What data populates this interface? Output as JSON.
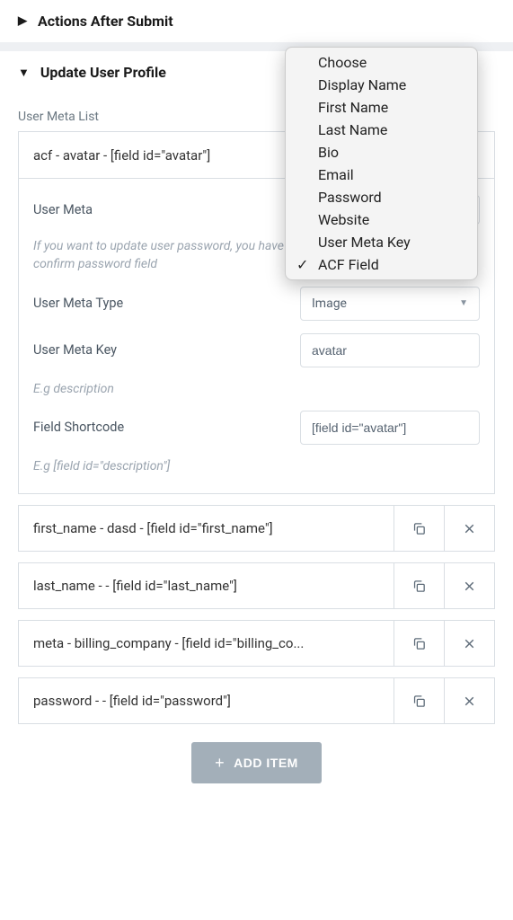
{
  "sections": {
    "actions_after_submit": {
      "title": "Actions After Submit"
    },
    "update_user_profile": {
      "title": "Update User Profile"
    }
  },
  "user_meta_list_label": "User Meta List",
  "expanded_item": {
    "title": "acf - avatar - [field id=\"avatar\"]",
    "user_meta_label": "User Meta",
    "user_meta_note": "If you want to update user password, you have to create a password field and confirm password field",
    "user_meta_type_label": "User Meta Type",
    "user_meta_type_value": "Image",
    "user_meta_key_label": "User Meta Key",
    "user_meta_key_value": "avatar",
    "user_meta_key_hint": "E.g description",
    "field_shortcode_label": "Field Shortcode",
    "field_shortcode_value": "[field id=\"avatar\"]",
    "field_shortcode_hint": "E.g [field id=\"description\"]"
  },
  "list_items": [
    {
      "title": "first_name - dasd - [field id=\"first_name\"]"
    },
    {
      "title": "last_name - - [field id=\"last_name\"]"
    },
    {
      "title": "meta - billing_company - [field id=\"billing_co..."
    },
    {
      "title": "password - - [field id=\"password\"]"
    }
  ],
  "add_item_label": "ADD ITEM",
  "dropdown": {
    "options": [
      "Choose",
      "Display Name",
      "First Name",
      "Last Name",
      "Bio",
      "Email",
      "Password",
      "Website",
      "User Meta Key",
      "ACF Field"
    ],
    "selected": "ACF Field"
  }
}
